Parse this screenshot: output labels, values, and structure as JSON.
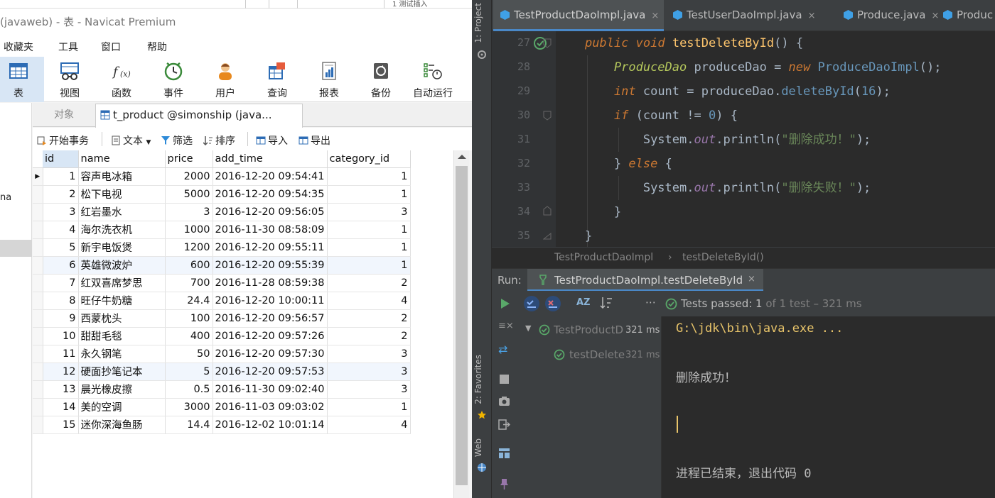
{
  "navicat": {
    "title": "(javaweb) - 表 - Navicat Premium",
    "top_strip_text": "1 测试插入",
    "menu": [
      "收藏夹",
      "工具",
      "窗口",
      "帮助"
    ],
    "toolbar": [
      {
        "label": "表",
        "icon": "table-icon",
        "active": true
      },
      {
        "label": "视图",
        "icon": "view-icon"
      },
      {
        "label": "函数",
        "icon": "function-icon"
      },
      {
        "label": "事件",
        "icon": "event-clock-icon"
      },
      {
        "label": "用户",
        "icon": "user-icon"
      },
      {
        "label": "查询",
        "icon": "query-icon"
      },
      {
        "label": "报表",
        "icon": "report-icon"
      },
      {
        "label": "备份",
        "icon": "backup-icon"
      },
      {
        "label": "自动运行",
        "icon": "schedule-icon"
      }
    ],
    "sidebar_fragment": "na",
    "tabs": {
      "objects": "对象",
      "table_tab": "t_product @simonship (java..."
    },
    "actions": {
      "begin_tx": "开始事务",
      "text": "文本",
      "filter": "筛选",
      "sort": "排序",
      "import": "导入",
      "export": "导出"
    },
    "grid": {
      "columns": [
        "id",
        "name",
        "price",
        "add_time",
        "category_id"
      ],
      "rows": [
        [
          "1",
          "容声电冰箱",
          "2000",
          "2016-12-20 09:54:41",
          "1"
        ],
        [
          "2",
          "松下电视",
          "5000",
          "2016-12-20 09:54:35",
          "1"
        ],
        [
          "3",
          "红岩墨水",
          "3",
          "2016-12-20 09:56:05",
          "3"
        ],
        [
          "4",
          "海尔洗衣机",
          "1000",
          "2016-11-30 08:58:09",
          "1"
        ],
        [
          "5",
          "新宇电饭煲",
          "1200",
          "2016-12-20 09:55:11",
          "1"
        ],
        [
          "6",
          "英雄微波炉",
          "600",
          "2016-12-20 09:55:39",
          "1"
        ],
        [
          "7",
          "红双喜席梦思",
          "700",
          "2016-11-28 08:59:38",
          "2"
        ],
        [
          "8",
          "旺仔牛奶糖",
          "24.4",
          "2016-12-20 10:00:11",
          "4"
        ],
        [
          "9",
          "西蒙枕头",
          "100",
          "2016-12-20 09:56:57",
          "2"
        ],
        [
          "10",
          "甜甜毛毯",
          "400",
          "2016-12-20 09:57:26",
          "2"
        ],
        [
          "11",
          "永久钢笔",
          "50",
          "2016-12-20 09:57:30",
          "3"
        ],
        [
          "12",
          "硬面抄笔记本",
          "5",
          "2016-12-20 09:57:53",
          "3"
        ],
        [
          "13",
          "晨光橡皮擦",
          "0.5",
          "2016-11-30 09:02:40",
          "3"
        ],
        [
          "14",
          "美的空调",
          "3000",
          "2016-11-03 09:03:02",
          "1"
        ],
        [
          "15",
          "迷你深海鱼肠",
          "14.4",
          "2016-12-02 10:01:14",
          "4"
        ]
      ]
    }
  },
  "ide": {
    "side_labels": {
      "project": "1: Project",
      "favorites": "2: Favorites",
      "web": "Web"
    },
    "tabs": [
      {
        "label": "TestProductDaoImpl.java",
        "active": true
      },
      {
        "label": "TestUserDaoImpl.java"
      },
      {
        "label": "Produce.java"
      },
      {
        "label": "Produc"
      }
    ],
    "tab_close": "×",
    "line_numbers": [
      "27",
      "28",
      "29",
      "30",
      "31",
      "32",
      "33",
      "34",
      "35"
    ],
    "code": {
      "l27": {
        "kw1": "public",
        "kw2": "void",
        "name": "testDeleteById",
        "rest": "() {"
      },
      "l28": {
        "type": "ProduceDao",
        "var": " produceDao = ",
        "kw": "new",
        "cls": " ProduceDaoImpl",
        "rest": "();"
      },
      "l29": {
        "kw": "int",
        "pre": " count = produceDao.",
        "method": "deleteById",
        "open": "(",
        "num": "16",
        "close": ");"
      },
      "l30": {
        "kw": "if",
        "pre": " (count != ",
        "num": "0",
        "close": ") {"
      },
      "l31": {
        "sys": "System.",
        "out": "out",
        "call": ".println(",
        "str": "\"删除成功！\"",
        "end": ");"
      },
      "l32": {
        "open": "} ",
        "kw": "else",
        "close": " {"
      },
      "l33": {
        "sys": "System.",
        "out": "out",
        "call": ".println(",
        "str": "\"删除失败！\"",
        "end": ");"
      },
      "l34": "}",
      "l35": "}"
    },
    "breadcrumb": [
      "TestProductDaoImpl",
      "testDeleteById()"
    ],
    "run": {
      "label": "Run:",
      "tab": "TestProductDaoImpl.testDeleteById",
      "status_prefix": "Tests passed: ",
      "status_count": "1",
      "status_rest": " of 1 test – 321 ms",
      "tree": [
        {
          "label": "TestProductD",
          "time": "321 ms"
        },
        {
          "label": "testDelete",
          "time": "321 ms"
        }
      ],
      "console": [
        "G:\\jdk\\bin\\java.exe ...",
        "删除成功！",
        "进程已结束，退出代码 0"
      ]
    },
    "colors": {
      "keyword": "#cc7832",
      "string": "#6a8759",
      "number": "#6897bb",
      "method": "#ffc66d",
      "accent": "#4a88c7",
      "pass": "#59a869"
    }
  }
}
